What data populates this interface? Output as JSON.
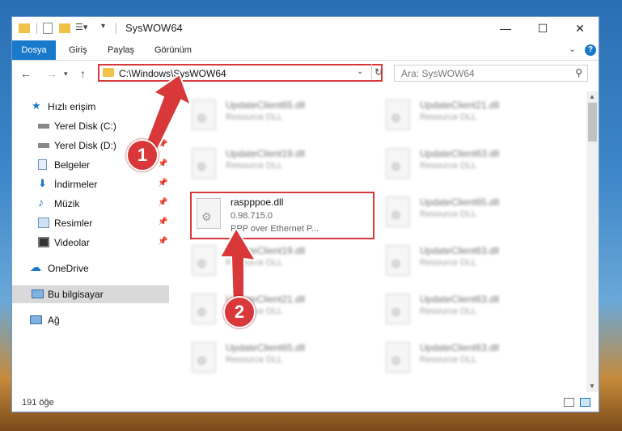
{
  "window": {
    "title": "SysWOW64"
  },
  "ribbon": {
    "tabs": [
      "Dosya",
      "Giriş",
      "Paylaş",
      "Görünüm"
    ]
  },
  "address": {
    "path": "C:\\Windows\\SysWOW64"
  },
  "search": {
    "placeholder": "Ara: SysWOW64"
  },
  "navpane": {
    "items": [
      {
        "label": "Hızlı erişim",
        "icon": "star-icon",
        "pinned": false
      },
      {
        "label": "Yerel Disk (C:)",
        "icon": "drive-icon",
        "pinned": true
      },
      {
        "label": "Yerel Disk (D:)",
        "icon": "drive-icon",
        "pinned": true
      },
      {
        "label": "Belgeler",
        "icon": "documents-icon",
        "pinned": true
      },
      {
        "label": "İndirmeler",
        "icon": "download-icon",
        "pinned": true
      },
      {
        "label": "Müzik",
        "icon": "music-icon",
        "pinned": true
      },
      {
        "label": "Resimler",
        "icon": "pictures-icon",
        "pinned": true
      },
      {
        "label": "Videolar",
        "icon": "videos-icon",
        "pinned": true
      },
      {
        "label": "OneDrive",
        "icon": "cloud-icon",
        "pinned": false
      },
      {
        "label": "Bu bilgisayar",
        "icon": "computer-icon",
        "pinned": false,
        "selected": true
      },
      {
        "label": "Ağ",
        "icon": "network-icon",
        "pinned": false
      }
    ]
  },
  "files": {
    "left": [
      {
        "name": "UpdateClient65.dll",
        "type": "Resource DLL"
      },
      {
        "name": "UpdateClient19.dll",
        "type": "Resource DLL"
      },
      {
        "name": "raspppoe.dll",
        "version": "0.98.715.0",
        "type": "PPP over Ethernet P...",
        "focus": true
      },
      {
        "name": "UpdateClient19.dll",
        "type": "Resource DLL"
      },
      {
        "name": "UpdateClient21.dll",
        "type": "Resource DLL"
      },
      {
        "name": "UpdateClient65.dll",
        "type": "Resource DLL"
      }
    ],
    "right": [
      {
        "name": "UpdateClient21.dll",
        "type": "Resource DLL"
      },
      {
        "name": "UpdateClient63.dll",
        "type": "Resource DLL"
      },
      {
        "name": "UpdateClient65.dll",
        "type": "Resource DLL"
      },
      {
        "name": "UpdateClient63.dll",
        "type": "Resource DLL"
      },
      {
        "name": "UpdateClient63.dll",
        "type": "Resource DLL"
      },
      {
        "name": "UpdateClient63.dll",
        "type": "Resource DLL"
      }
    ]
  },
  "status": {
    "count": "191 öğe"
  },
  "annotations": {
    "step1": "1",
    "step2": "2"
  },
  "colors": {
    "accent": "#1979ca",
    "highlight": "#d9383a"
  }
}
